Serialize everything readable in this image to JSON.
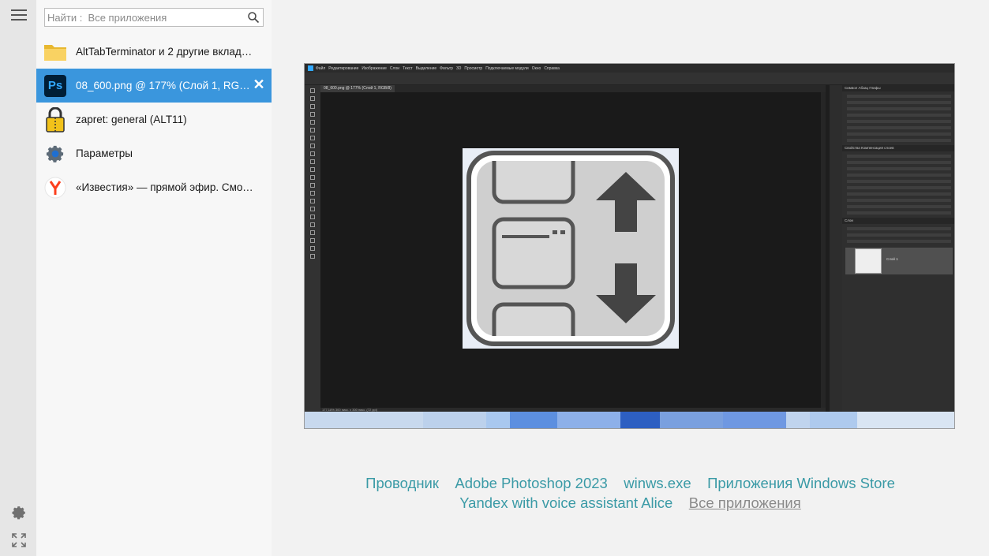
{
  "search": {
    "placeholder": "Найти :  Все приложения"
  },
  "windows": [
    {
      "label": "AltTabTerminator и 2 другие вкладк...",
      "icon": "folder-icon",
      "active": false
    },
    {
      "label": "08_600.png @ 177% (Слой 1, RGB/8)",
      "icon": "photoshop-icon",
      "active": true,
      "icon_text": "Ps"
    },
    {
      "label": "zapret: general (ALT11)",
      "icon": "zipper-lock-icon",
      "active": false
    },
    {
      "label": "Параметры",
      "icon": "settings-gear-icon",
      "active": false
    },
    {
      "label": "«Известия» — прямой эфир. Смот...",
      "icon": "yandex-browser-icon",
      "active": false
    }
  ],
  "close_glyph": "✕",
  "preview": {
    "ps_menu": [
      "Файл",
      "Редактирование",
      "Изображение",
      "Слои",
      "Текст",
      "Выделение",
      "Фильтр",
      "3D",
      "Просмотр",
      "Подключаемые модули",
      "Окно",
      "Справка"
    ],
    "ps_tab": "08_600.png @ 177% (Слой 1, RGB/8)",
    "ps_status": "177,18%   300 пикс. x 300 пикс. (72 ppi)",
    "ps_panel_headers": [
      "Символ  Абзац  Глифы",
      "Свойства  Компенсация слоев",
      "Слои"
    ],
    "ps_layer_name": "Слой 1"
  },
  "links": {
    "row1": [
      "Проводник",
      "Adobe Photoshop 2023",
      "winws.exe",
      "Приложения Windows Store"
    ],
    "row2": [
      "Yandex with voice assistant Alice"
    ],
    "all_apps": "Все приложения"
  },
  "colors": {
    "accent": "#3a96dd",
    "link": "#3a9aa6",
    "photoshop_blue": "#31a8ff"
  }
}
